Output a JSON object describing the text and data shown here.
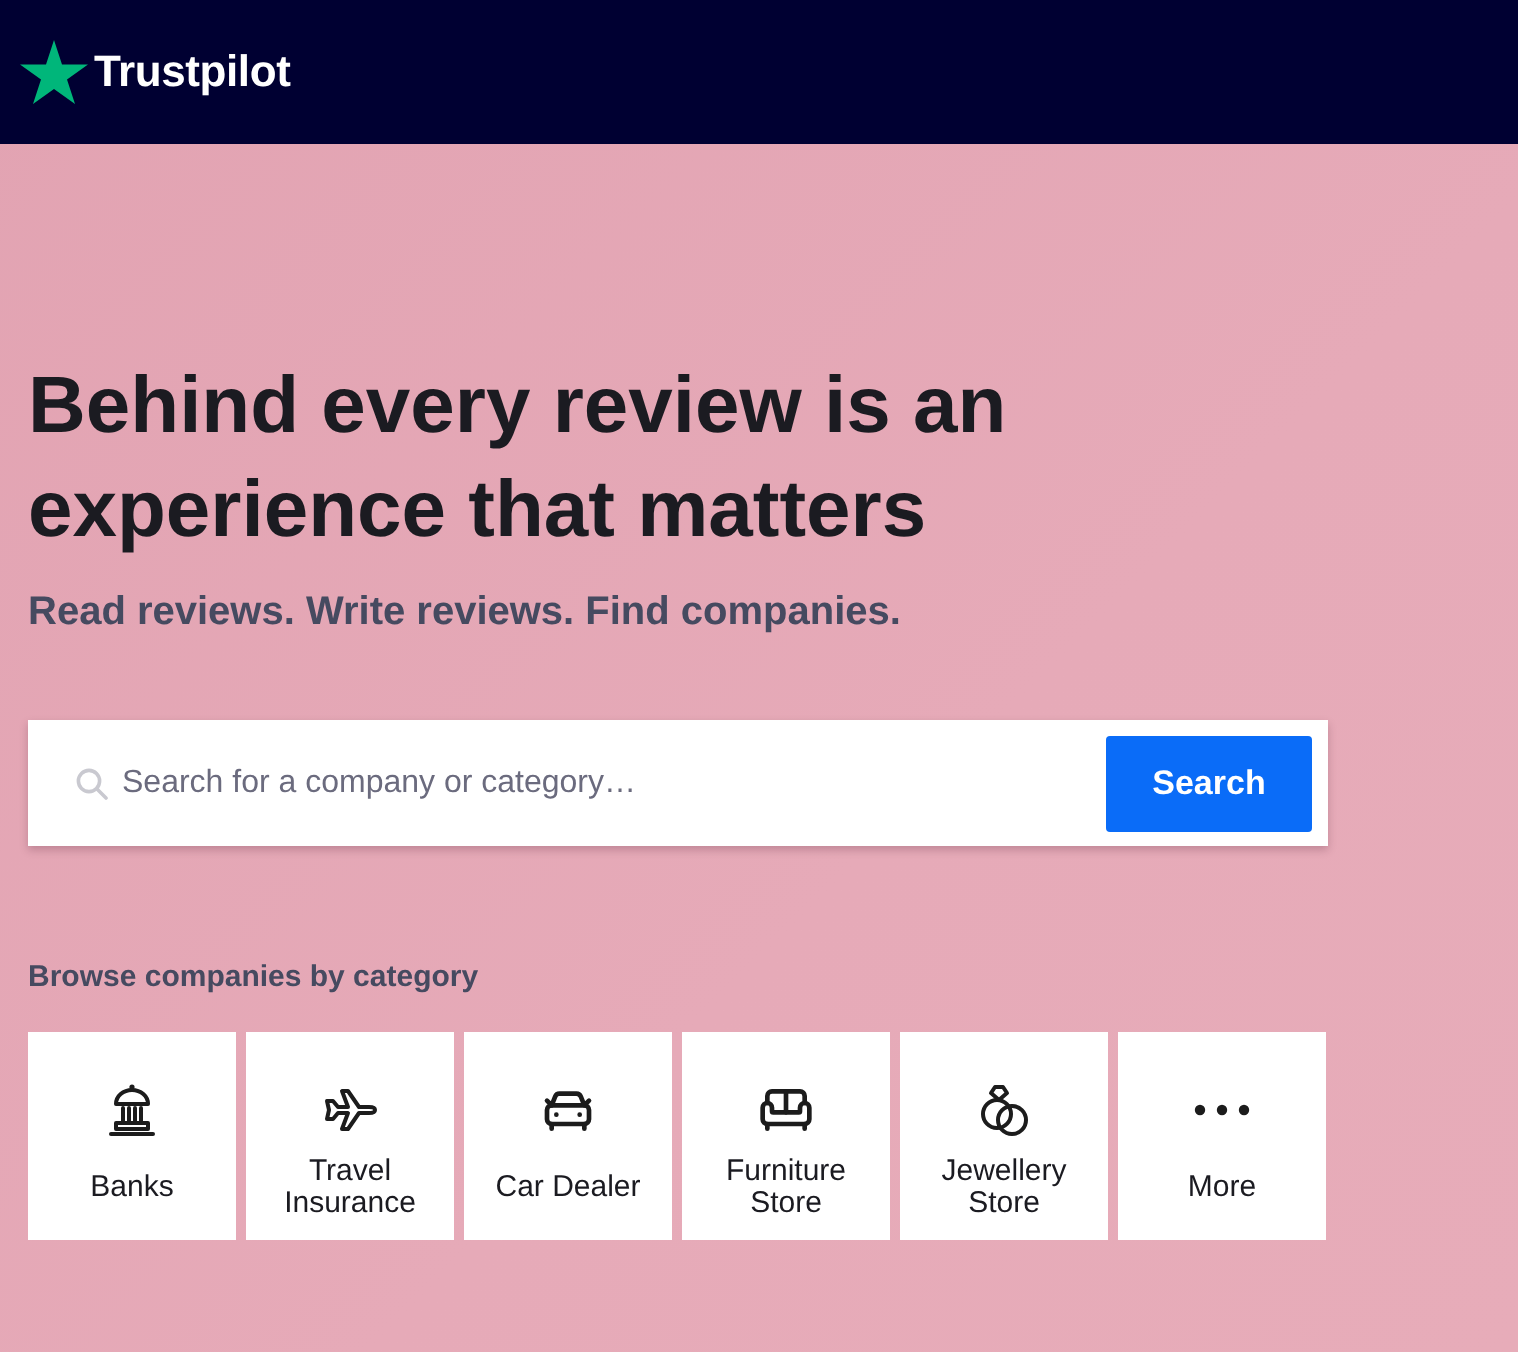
{
  "header": {
    "logo": {
      "text": "Trustpilot"
    }
  },
  "hero": {
    "headline": "Behind every review is an experience that matters",
    "subtitle": "Read reviews. Write reviews. Find companies.",
    "search": {
      "placeholder": "Search for a company or category…",
      "button": "Search"
    }
  },
  "categories": {
    "heading": "Browse companies by category",
    "items": [
      {
        "kind": "bank",
        "label": "Banks"
      },
      {
        "kind": "plane",
        "label": "Travel Insurance"
      },
      {
        "kind": "car",
        "label": "Car Dealer"
      },
      {
        "kind": "sofa",
        "label": "Furniture Store"
      },
      {
        "kind": "rings",
        "label": "Jewellery Store"
      },
      {
        "kind": "more",
        "label": "More"
      }
    ]
  }
}
